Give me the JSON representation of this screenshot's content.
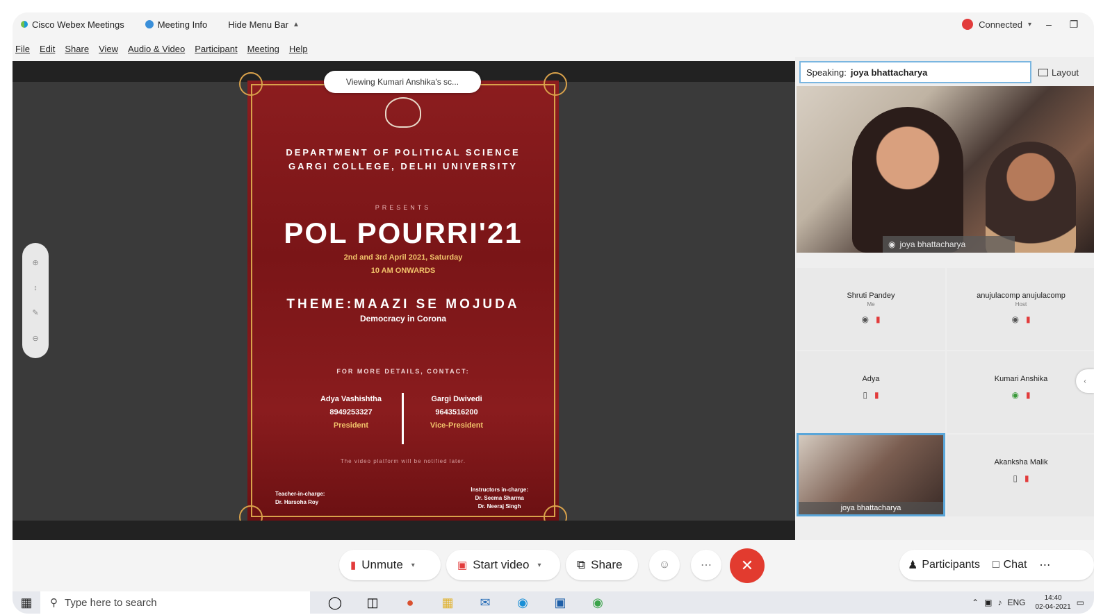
{
  "titlebar": {
    "app_name": "Cisco Webex Meetings",
    "meeting_info": "Meeting Info",
    "hide_menu": "Hide Menu Bar",
    "connection": "Connected",
    "connection_color": "#e23b3b"
  },
  "menu": [
    "File",
    "Edit",
    "Share",
    "View",
    "Audio & Video",
    "Participant",
    "Meeting",
    "Help"
  ],
  "stage": {
    "viewing": "Viewing Kumari Anshika's sc..."
  },
  "poster": {
    "dept_line1": "DEPARTMENT OF POLITICAL SCIENCE",
    "dept_line2": "GARGI COLLEGE, DELHI UNIVERSITY",
    "presents": "PRESENTS",
    "title": "POL POURRI'21",
    "date_line1": "2nd and 3rd April 2021, Saturday",
    "date_line2": "10 AM ONWARDS",
    "theme": "THEME:MAAZI SE MOJUDA",
    "theme_sub": "Democracy in Corona",
    "contact_header": "FOR MORE DETAILS, CONTACT:",
    "contact_left": {
      "name": "Adya Vashishtha",
      "phone": "8949253327",
      "role": "President"
    },
    "contact_right": {
      "name": "Gargi Dwivedi",
      "phone": "9643516200",
      "role": "Vice-President"
    },
    "note": "The video platform will be notified later.",
    "teacher_label": "Teacher-in-charge:",
    "teacher_name": "Dr. Harsoha Roy",
    "mentor_label": "Instructors in-charge:",
    "mentor_name1": "Dr. Seema Sharma",
    "mentor_name2": "Dr. Neeraj Singh",
    "accent_color": "#d9a24b"
  },
  "panel": {
    "speaking_label": "Speaking:",
    "speaking_name": "joya bhattacharya",
    "layout": "Layout",
    "main_video_name": "joya bhattacharya",
    "participants": [
      {
        "name": "Shruti Pandey",
        "role": "Me"
      },
      {
        "name": "anujulacomp anujulacomp",
        "role": "Host"
      },
      {
        "name": "Adya",
        "role": ""
      },
      {
        "name": "Kumari Anshika",
        "role": ""
      },
      {
        "name": "Akanksha Malik",
        "role": ""
      }
    ],
    "self_video_name": "joya bhattacharya"
  },
  "controls": {
    "unmute": "Unmute",
    "start_video": "Start video",
    "share": "Share",
    "participants": "Participants",
    "chat": "Chat",
    "end_color": "#e23b2f"
  },
  "taskbar": {
    "search_placeholder": "Type here to search",
    "lang": "ENG",
    "time": "14:40",
    "date": "02-04-2021"
  }
}
